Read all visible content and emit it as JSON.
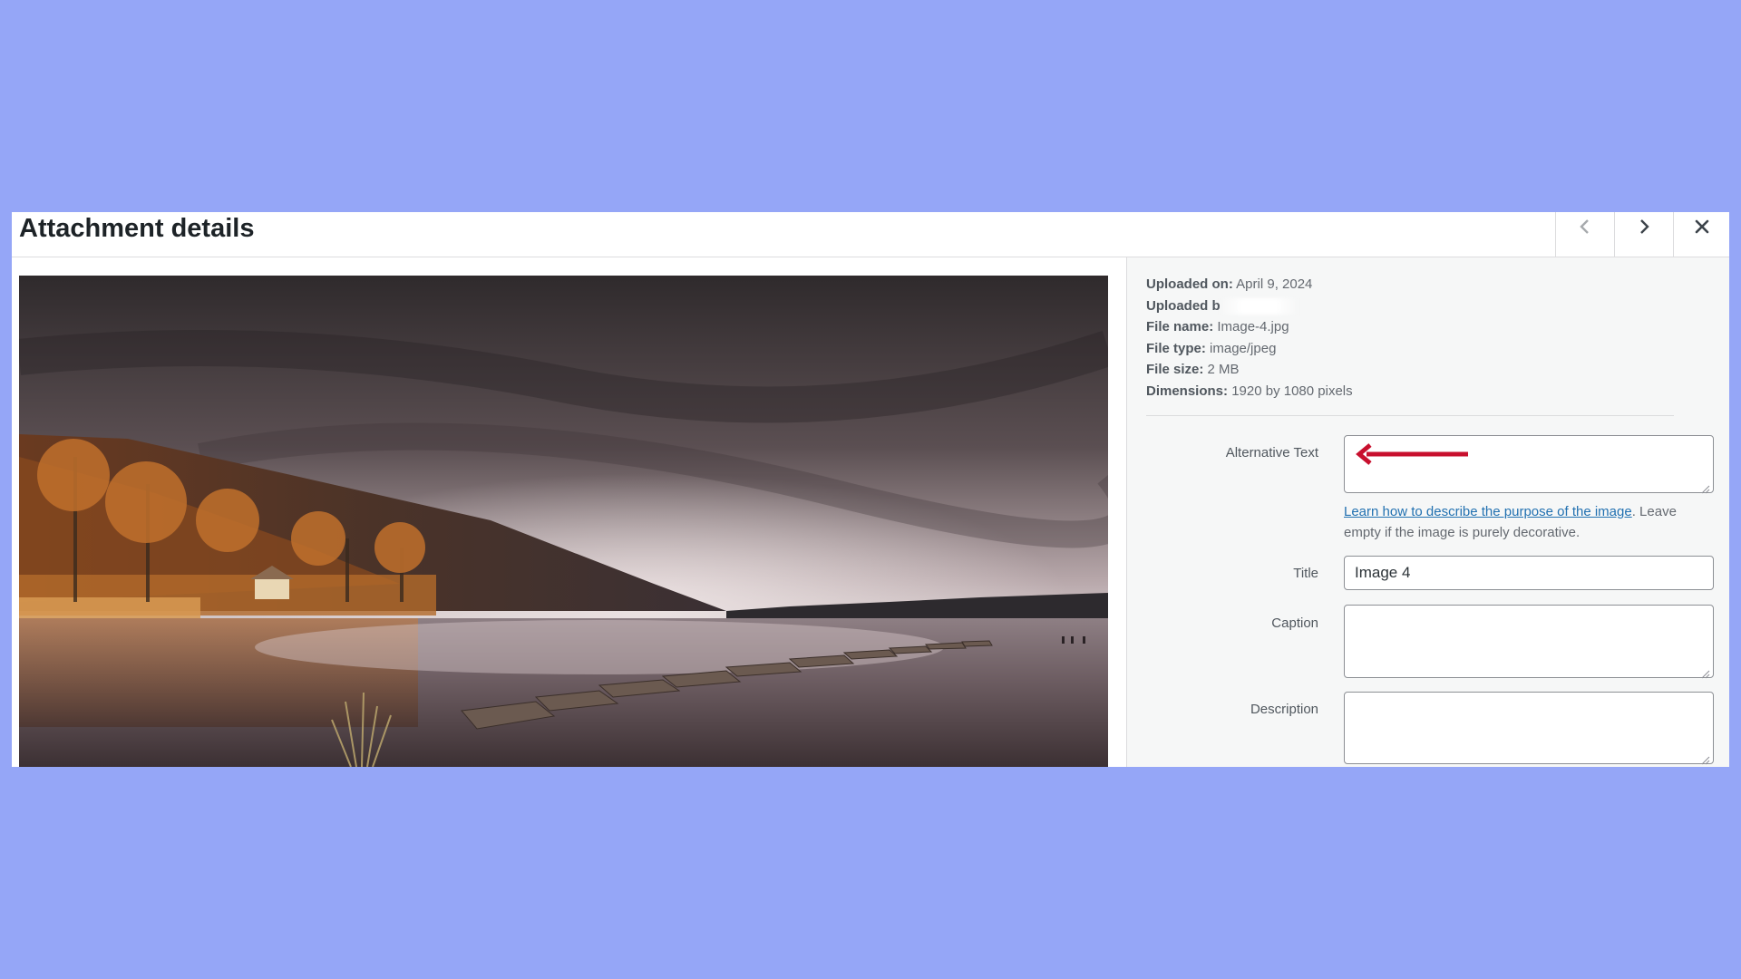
{
  "header": {
    "title": "Attachment details",
    "prev_icon": "chevron-left-icon",
    "next_icon": "chevron-right-icon",
    "close_icon": "close-icon"
  },
  "preview": {
    "image_icon": "landscape-photo"
  },
  "meta": {
    "uploaded_on_label": "Uploaded on:",
    "uploaded_on_value": "April 9, 2024",
    "uploaded_by_label": "Uploaded b",
    "file_name_label": "File name:",
    "file_name_value": "Image-4.jpg",
    "file_type_label": "File type:",
    "file_type_value": "image/jpeg",
    "file_size_label": "File size:",
    "file_size_value": "2 MB",
    "dimensions_label": "Dimensions:",
    "dimensions_value": "1920 by 1080 pixels"
  },
  "fields": {
    "alt_label": "Alternative Text",
    "alt_value": "",
    "help_link": "Learn how to describe the purpose of the image",
    "help_rest": ". Leave empty if the image is purely decorative.",
    "title_label": "Title",
    "title_value": "Image 4",
    "caption_label": "Caption",
    "caption_value": "",
    "description_label": "Description",
    "description_value": ""
  },
  "colors": {
    "page_background": "#95a6f7",
    "annotation_arrow": "#c8102e",
    "link": "#2271b1"
  }
}
